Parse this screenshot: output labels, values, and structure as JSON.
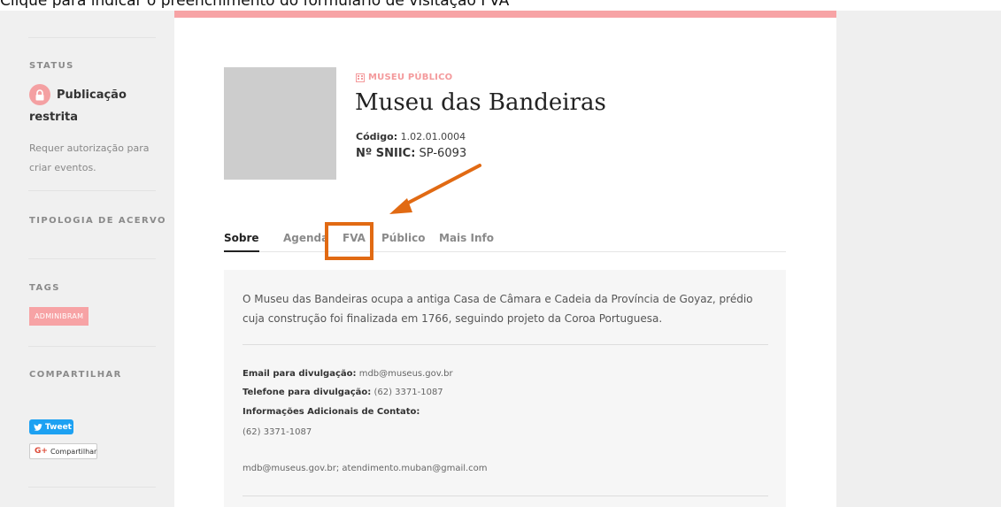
{
  "caption": "Clique para indicar o preenchimento do formulário de visitação FVA",
  "sidebar": {
    "status_heading": "STATUS",
    "status_line1": "Publicação",
    "status_line2": "restrita",
    "status_note": "Requer autorização para criar eventos.",
    "acervo_heading": "TIPOLOGIA DE ACERVO",
    "tags_heading": "TAGS",
    "tag": "ADMINIBRAM",
    "share_heading": "COMPARTILHAR",
    "tweet_label": "Tweet",
    "gplus_label": "Compartilhar"
  },
  "museum": {
    "type": "MUSEU PÚBLICO",
    "name": "Museu das Bandeiras",
    "code_label": "Código:",
    "code_value": "1.02.01.0004",
    "sniic_label": "Nº SNIIC:",
    "sniic_value": "SP-6093"
  },
  "tabs": [
    "Sobre",
    "Agenda",
    "FVA",
    "Público",
    "Mais Info"
  ],
  "about": {
    "description": "O Museu das Bandeiras ocupa a antiga Casa de Câmara e Cadeia da Província de Goyaz, prédio cuja construção foi finalizada em 1766, seguindo projeto da Coroa Portuguesa.",
    "email_label": "Email para divulgação:",
    "email_value": "mdb@museus.gov.br",
    "phone_label": "Telefone para divulgação:",
    "phone_value": "(62) 3371-1087",
    "extra_label": "Informações Adicionais de Contato:",
    "extra_phone": "(62) 3371-1087",
    "extra_emails": "mdb@museus.gov.br; atendimento.muban@gmail.com"
  },
  "colors": {
    "accent_pink": "#f7a3a5",
    "highlight_orange": "#e16a13",
    "tweet_blue": "#1da1f2"
  }
}
